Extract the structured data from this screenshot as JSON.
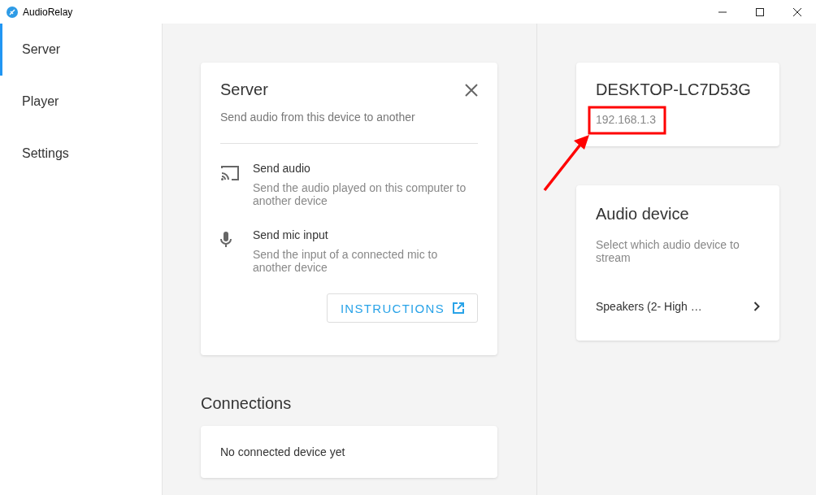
{
  "window": {
    "title": "AudioRelay"
  },
  "sidebar": {
    "items": [
      {
        "label": "Server",
        "selected": true
      },
      {
        "label": "Player",
        "selected": false
      },
      {
        "label": "Settings",
        "selected": false
      }
    ]
  },
  "server_card": {
    "title": "Server",
    "subtitle": "Send audio from this device to another",
    "options": [
      {
        "kind": "cast",
        "title": "Send audio",
        "description": "Send the audio played on this computer to another device"
      },
      {
        "kind": "mic",
        "title": "Send mic input",
        "description": "Send the input of a connected mic to another device"
      }
    ],
    "button": "INSTRUCTIONS"
  },
  "connections": {
    "title": "Connections",
    "empty_text": "No connected device yet"
  },
  "device_card": {
    "name": "DESKTOP-LC7D53G",
    "ip": "192.168.1.3"
  },
  "audio_device_card": {
    "title": "Audio device",
    "description": "Select which audio device to stream",
    "device": "Speakers (2- High …"
  }
}
